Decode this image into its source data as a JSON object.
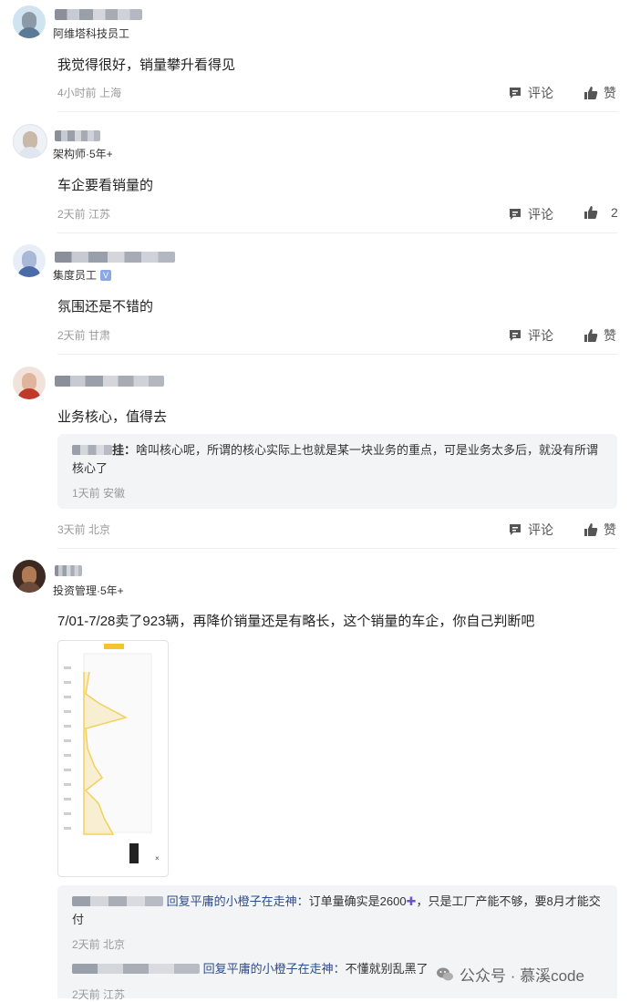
{
  "actions": {
    "comment_label": "评论",
    "like_label": "赞"
  },
  "comments": [
    {
      "role": "阿维塔科技员工",
      "text": "我觉得很好，销量攀升看得见",
      "meta": "4小时前 上海",
      "likes": "赞"
    },
    {
      "role": "架构师·5年+",
      "text": "车企要看销量的",
      "meta": "2天前 江苏",
      "likes": "2"
    },
    {
      "role": "集度员工",
      "text": "氛围还是不错的",
      "meta": "2天前 甘肃",
      "likes": "赞"
    },
    {
      "role": "",
      "text": "业务核心，值得去",
      "meta": "3天前 北京",
      "likes": "赞",
      "reply": {
        "author_suffix": "挂",
        "text": "啥叫核心呢，所谓的核心实际上也就是某一块业务的重点，可是业务太多后，就没有所谓核心了",
        "meta": "1天前 安徽"
      }
    },
    {
      "role": "投资管理·5年+",
      "text": "7/01-7/28卖了923辆，再降价销量还是有略长，这个销量的车企，你自己判断吧",
      "replies": [
        {
          "reply_to": "回复平庸的小橙子在走神",
          "text": "订单量确实是2600",
          "text_tail": "，只是工厂产能不够，要8月才能交付",
          "meta": "2天前 北京"
        },
        {
          "reply_to": "回复平庸的小橙子在走神",
          "text": "不懂就别乱黑了",
          "meta": "2天前 江苏"
        }
      ]
    }
  ],
  "watermark": {
    "text": "公众号 · 慕溪code",
    "icon": "wechat-icon"
  },
  "colors": {
    "accent_link": "#2f4c8a",
    "meta": "#9a9a9a",
    "chart_line": "#f2d15a"
  }
}
